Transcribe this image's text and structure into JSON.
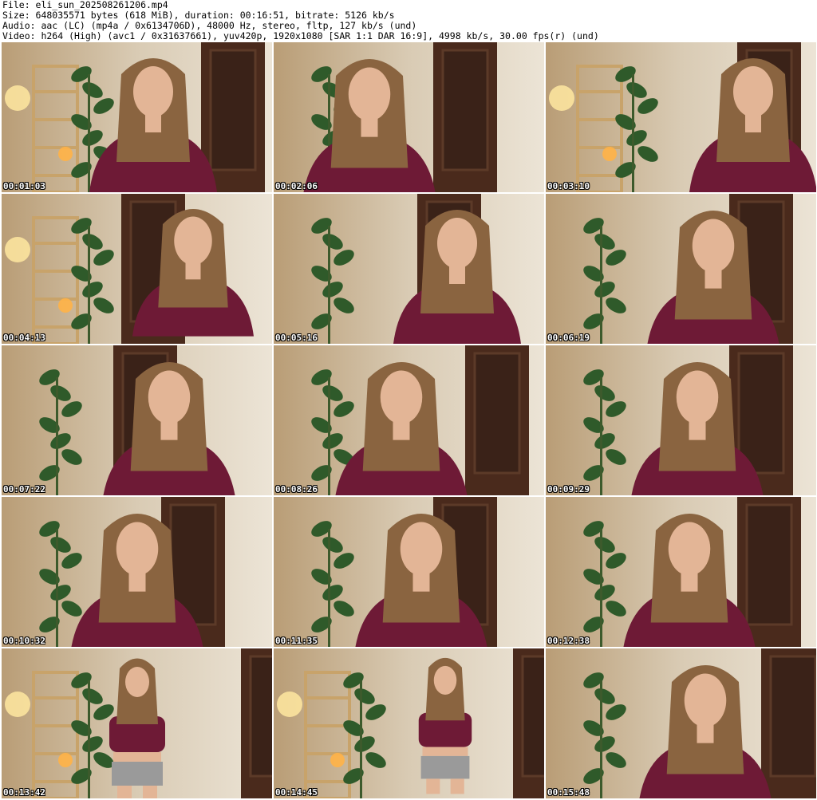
{
  "header": {
    "file_line": "File: eli_sun_202508261206.mp4",
    "size_line": "Size: 648035571 bytes (618 MiB), duration: 00:16:51, bitrate: 5126 kb/s",
    "audio_line": "Audio: aac (LC) (mp4a / 0x6134706D), 48000 Hz, stereo, fltp, 127 kb/s (und)",
    "video_line": "Video: h264 (High) (avc1 / 0x31637661), yuv420p, 1920x1080 [SAR 1:1 DAR 16:9], 4998 kb/s, 30.00 fps(r) (und)"
  },
  "thumbnails": [
    {
      "timestamp": "00:01:03"
    },
    {
      "timestamp": "00:02:06"
    },
    {
      "timestamp": "00:03:10"
    },
    {
      "timestamp": "00:04:13"
    },
    {
      "timestamp": "00:05:16"
    },
    {
      "timestamp": "00:06:19"
    },
    {
      "timestamp": "00:07:22"
    },
    {
      "timestamp": "00:08:26"
    },
    {
      "timestamp": "00:09:29"
    },
    {
      "timestamp": "00:10:32"
    },
    {
      "timestamp": "00:11:35"
    },
    {
      "timestamp": "00:12:38"
    },
    {
      "timestamp": "00:13:42"
    },
    {
      "timestamp": "00:14:45"
    },
    {
      "timestamp": "00:15:48"
    }
  ],
  "colors": {
    "wall": "#d9cbb4",
    "door": "#4a2a1c",
    "shirt": "#6e1a36",
    "hair": "#8a6440",
    "skin": "#e3b596",
    "plant": "#2f5a2a",
    "shelf": "#c8a36a",
    "lamp": "#ffe7a0"
  }
}
